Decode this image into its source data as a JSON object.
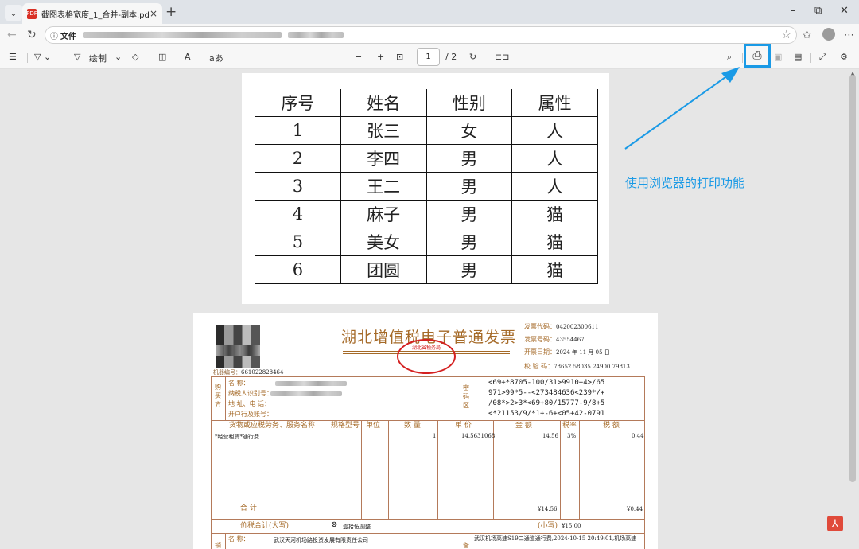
{
  "browser": {
    "tab_title": "截图表格宽度_1_合并-副本.pdf",
    "tab_close": "×",
    "new_tab": "+",
    "address_label": "文件",
    "window_controls": {
      "minimize": "–",
      "restore": "⧉",
      "close": "✕"
    }
  },
  "pdf_toolbar": {
    "draw_label": "绘制",
    "zoom_out": "−",
    "zoom_in": "+",
    "current_page": "1",
    "page_total": "/ 2"
  },
  "annotation": {
    "text": "使用浏览器的打印功能",
    "color": "#1a9ae6",
    "highlighted_control": "print-icon"
  },
  "page1_table": {
    "headers": [
      "序号",
      "姓名",
      "性别",
      "属性"
    ],
    "rows": [
      [
        "1",
        "张三",
        "女",
        "人"
      ],
      [
        "2",
        "李四",
        "男",
        "人"
      ],
      [
        "3",
        "王二",
        "男",
        "人"
      ],
      [
        "4",
        "麻子",
        "男",
        "猫"
      ],
      [
        "5",
        "美女",
        "男",
        "猫"
      ],
      [
        "6",
        "团圆",
        "男",
        "猫"
      ]
    ]
  },
  "invoice": {
    "title": "湖北增值税电子普通发票",
    "machine_label": "机器编号：",
    "machine_no": "661022828464",
    "seal_text": "湖北省税务局",
    "code_label": "发票代码：",
    "code": "042002300611",
    "number_label": "发票号码：",
    "number": "43554467",
    "date_label": "开票日期：",
    "date": "2024 年 11 月 05 日",
    "check_label": "校 验 码：",
    "check": "78652 58035 24900 79813",
    "buyer_label": "购买方",
    "buyer_fields": [
      "名          称：",
      "纳税人识别号：",
      "地 址、电 话：",
      "开户行及账号："
    ],
    "cipher_label": "密码区",
    "cipher": [
      "<69+*8705-100/31>9910+4>/65",
      "971>99*5--<273484636<239*/+",
      "/08*>2>3*<69+80/15777-9/8+5",
      "<*21153/9/*1+-6+<05+42-0791"
    ],
    "item_headers": [
      "货物或应税劳务、服务名称",
      "规格型号",
      "单位",
      "数 量",
      "单 价",
      "金 额",
      "税率",
      "税 额"
    ],
    "item": {
      "name": "*经营租赁*通行费",
      "qty": "1",
      "price": "14.5631068",
      "amount": "14.56",
      "rate": "3%",
      "tax": "0.44"
    },
    "total_label": "合        计",
    "total_amount": "¥14.56",
    "total_tax": "¥0.44",
    "grand_label": "价税合计(大写)",
    "grand_words": "壹拾伍圆整",
    "grand_small_label": "(小写)",
    "grand_small": "¥15.00",
    "seller_label": "销",
    "seller_name_label": "名        称：",
    "seller_name": "武汉天河机场路投资发展有限责任公司",
    "remark_label": "备",
    "remark": "武汉机场高速S19二通道通行费,2024-10-15 20:49:01,机场高速"
  }
}
